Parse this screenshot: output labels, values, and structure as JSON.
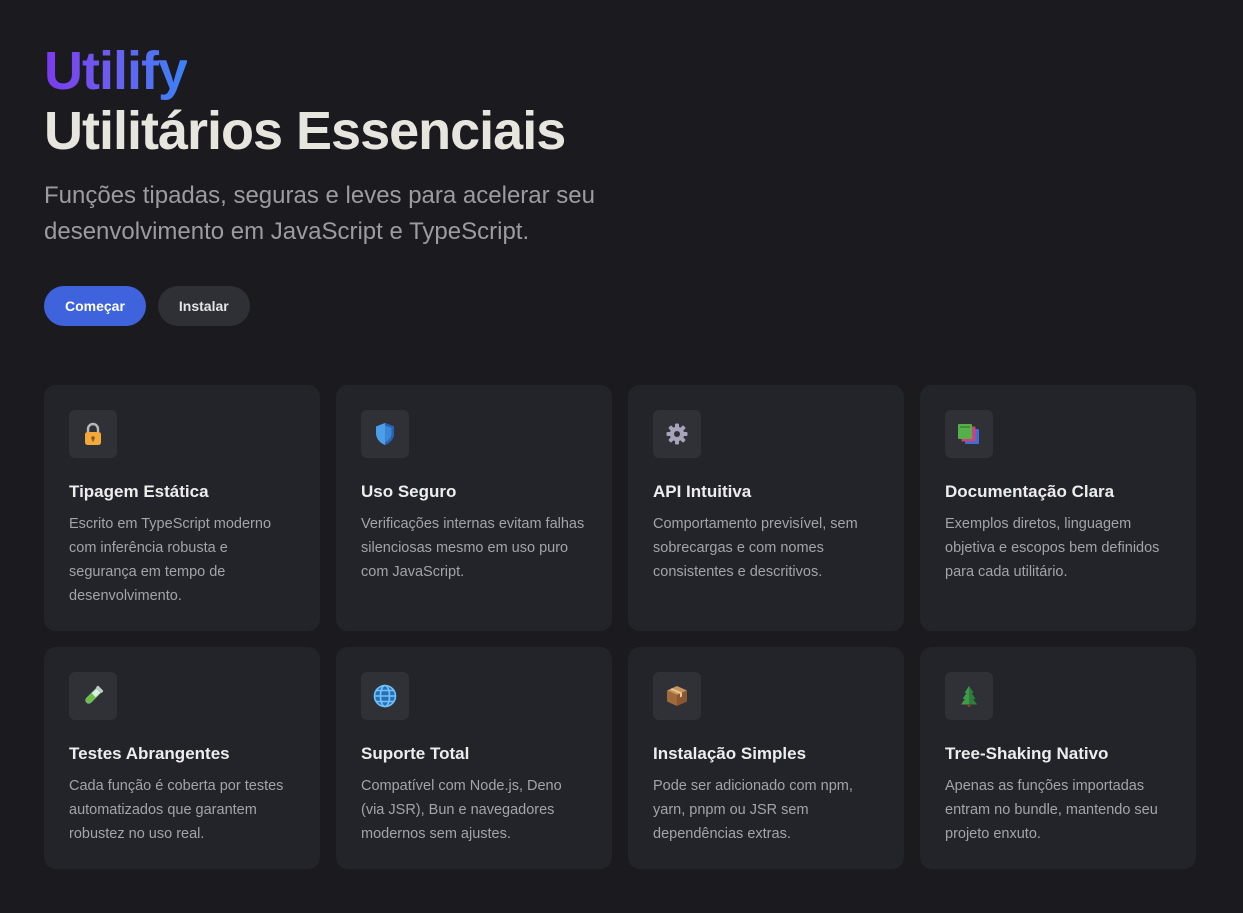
{
  "hero": {
    "brand": "Utilify",
    "headline": "Utilitários Essenciais",
    "tagline": "Funções tipadas, seguras e leves para acelerar seu desenvolvimento em JavaScript e TypeScript.",
    "primary_button": "Começar",
    "secondary_button": "Instalar",
    "colors": {
      "gradient_start": "#7c3aed",
      "gradient_end": "#3b82f6",
      "primary_button_bg": "#3e63dd",
      "background": "#1b1b1f"
    }
  },
  "features": [
    {
      "icon": "lock-icon",
      "title": "Tipagem Estática",
      "description": "Escrito em TypeScript moderno com inferência robusta e segurança em tempo de desenvolvimento."
    },
    {
      "icon": "shield-icon",
      "title": "Uso Seguro",
      "description": "Verificações internas evitam falhas silenciosas mesmo em uso puro com JavaScript."
    },
    {
      "icon": "gear-icon",
      "title": "API Intuitiva",
      "description": "Comportamento previsível, sem sobrecargas e com nomes consistentes e descritivos."
    },
    {
      "icon": "books-icon",
      "title": "Documentação Clara",
      "description": "Exemplos diretos, linguagem objetiva e escopos bem definidos para cada utilitário."
    },
    {
      "icon": "test-tube-icon",
      "title": "Testes Abrangentes",
      "description": "Cada função é coberta por testes automatizados que garantem robustez no uso real."
    },
    {
      "icon": "globe-icon",
      "title": "Suporte Total",
      "description": "Compatível com Node.js, Deno (via JSR), Bun e navegadores modernos sem ajustes."
    },
    {
      "icon": "package-icon",
      "title": "Instalação Simples",
      "description": "Pode ser adicionado com npm, yarn, pnpm ou JSR sem dependências extras."
    },
    {
      "icon": "tree-icon",
      "title": "Tree-Shaking Nativo",
      "description": "Apenas as funções importadas entram no bundle, mantendo seu projeto enxuto."
    }
  ]
}
